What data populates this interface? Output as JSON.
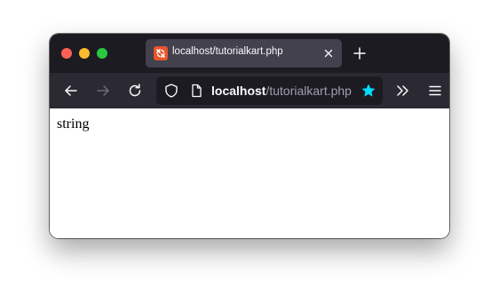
{
  "tab": {
    "title": "localhost/tutorialkart.php",
    "favicon": "xampp-favicon-icon"
  },
  "address_bar": {
    "host": "localhost",
    "path": "/tutorialkart.php"
  },
  "page": {
    "body_text": "string"
  },
  "colors": {
    "titlebar": "#1c1b22",
    "toolbar": "#2b2a33",
    "tab_active": "#42414d",
    "bookmark_star": "#00ddff",
    "close": "#fe5f57",
    "minimize": "#febc2e",
    "maximize": "#28c840"
  }
}
